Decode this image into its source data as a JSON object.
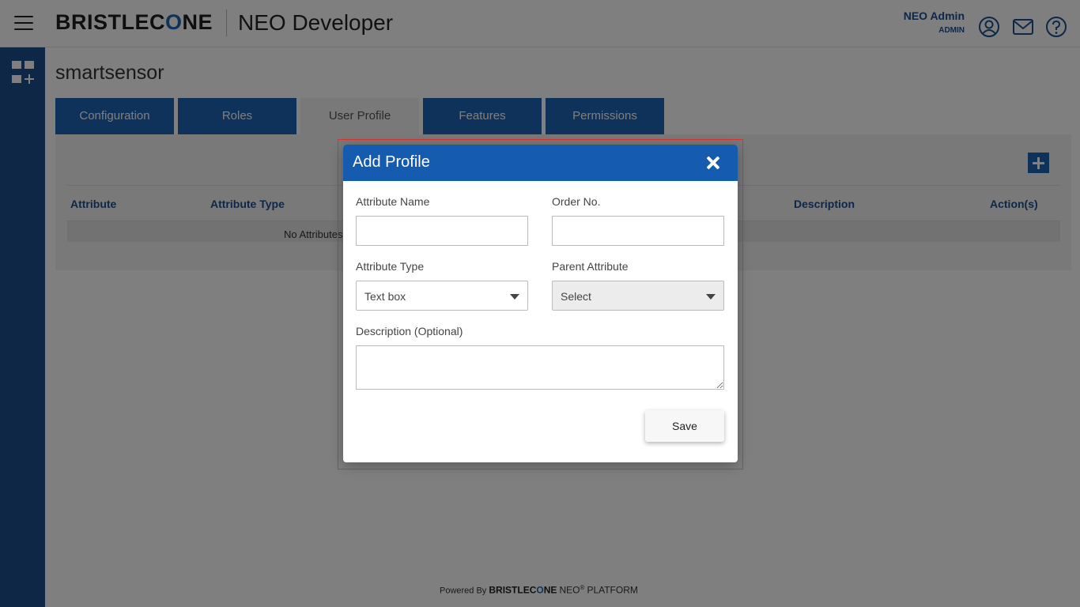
{
  "header": {
    "brand_prefix": "BRISTLEC",
    "brand_accent": "O",
    "brand_suffix": "NE",
    "app_title": "NEO Developer",
    "user_name": "NEO Admin",
    "user_role": "ADMIN",
    "icons": [
      "user-icon",
      "mail-icon",
      "help-icon"
    ]
  },
  "sidebar": {
    "icons": [
      "dashboard-add-icon"
    ]
  },
  "page": {
    "title": "smartsensor"
  },
  "tabs": [
    {
      "label": "Configuration",
      "active": false
    },
    {
      "label": "Roles",
      "active": false
    },
    {
      "label": "User Profile",
      "active": true
    },
    {
      "label": "Features",
      "active": false
    },
    {
      "label": "Permissions",
      "active": false
    }
  ],
  "table": {
    "columns": [
      "Attribute",
      "Attribute Type",
      "Description",
      "Action(s)"
    ],
    "empty_text": "No Attributes"
  },
  "modal": {
    "title": "Add Profile",
    "attribute_name_label": "Attribute Name",
    "attribute_name_value": "",
    "order_no_label": "Order No.",
    "order_no_value": "",
    "attribute_type_label": "Attribute Type",
    "attribute_type_value": "Text box",
    "parent_attribute_label": "Parent Attribute",
    "parent_attribute_value": "Select",
    "description_label": "Description (Optional)",
    "description_value": "",
    "save_label": "Save"
  },
  "footer": {
    "powered_by": "Powered By",
    "brand_prefix": "BRISTLEC",
    "brand_accent": "O",
    "brand_suffix": "NE",
    "neo": "NEO",
    "registered": "®",
    "platform": "PLATFORM"
  },
  "colors": {
    "primary": "#1e4f8c",
    "tab_blue": "#1e64b4",
    "modal_header": "#155bb0",
    "highlight_border": "#e03030"
  }
}
